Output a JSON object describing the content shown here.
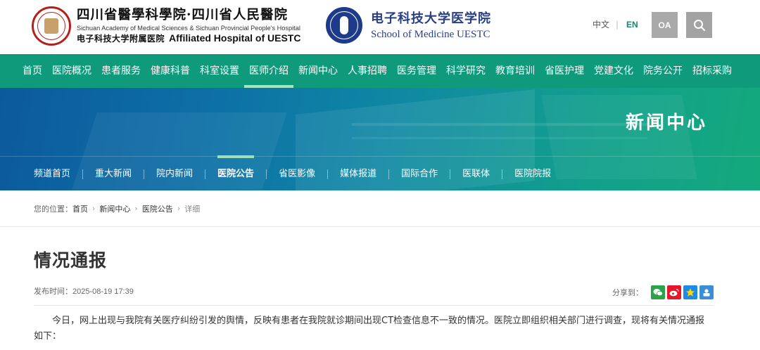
{
  "header": {
    "logo1": {
      "cn": "四川省醫學科學院·四川省人民醫院",
      "en": "Sichuan Academy of Medical Sciences & Sichuan Provincial People's Hospital",
      "cn2": "电子科技大学附属医院",
      "en2": "Affiliated Hospital of UESTC"
    },
    "logo2": {
      "cn": "电子科技大学医学院",
      "en": "School of Medicine UESTC"
    },
    "lang_zh": "中文",
    "lang_sep": "|",
    "lang_en": "EN",
    "oa": "OA",
    "search_icon": "search-icon"
  },
  "nav": {
    "items": [
      {
        "label": "首页"
      },
      {
        "label": "医院概况"
      },
      {
        "label": "患者服务"
      },
      {
        "label": "健康科普"
      },
      {
        "label": "科室设置"
      },
      {
        "label": "医师介绍"
      },
      {
        "label": "新闻中心"
      },
      {
        "label": "人事招聘"
      },
      {
        "label": "医务管理"
      },
      {
        "label": "科学研究"
      },
      {
        "label": "教育培训"
      },
      {
        "label": "省医护理"
      },
      {
        "label": "党建文化"
      },
      {
        "label": "院务公开"
      },
      {
        "label": "招标采购"
      }
    ],
    "active_index": 5
  },
  "banner": {
    "title": "新闻中心"
  },
  "subnav": {
    "items": [
      {
        "label": "频道首页"
      },
      {
        "label": "重大新闻"
      },
      {
        "label": "院内新闻"
      },
      {
        "label": "医院公告"
      },
      {
        "label": "省医影像"
      },
      {
        "label": "媒体报道"
      },
      {
        "label": "国际合作"
      },
      {
        "label": "医联体"
      },
      {
        "label": "医院院报"
      }
    ],
    "active_index": 3
  },
  "breadcrumb": {
    "label": "您的位置：",
    "items": [
      "首页",
      "新闻中心",
      "医院公告",
      "详细"
    ]
  },
  "article": {
    "title": "情况通报",
    "published_label": "发布时间：",
    "published_time": "2025-08-19 17:39",
    "share_label": "分享到：",
    "share_icons": [
      "wechat-icon",
      "weibo-icon",
      "qzone-icon",
      "tencent-weibo-icon"
    ],
    "body": "今日，网上出现与我院有关医疗纠纷引发的舆情，反映有患者在我院就诊期间出现CT检查信息不一致的情况。医院立即组织相关部门进行调查，现将有关情况通报如下："
  },
  "colors": {
    "nav_green": "#0e9a7b",
    "accent_green": "#a6e3bf",
    "brand_red": "#b3211b",
    "brand_blue": "#1d3b8a"
  }
}
